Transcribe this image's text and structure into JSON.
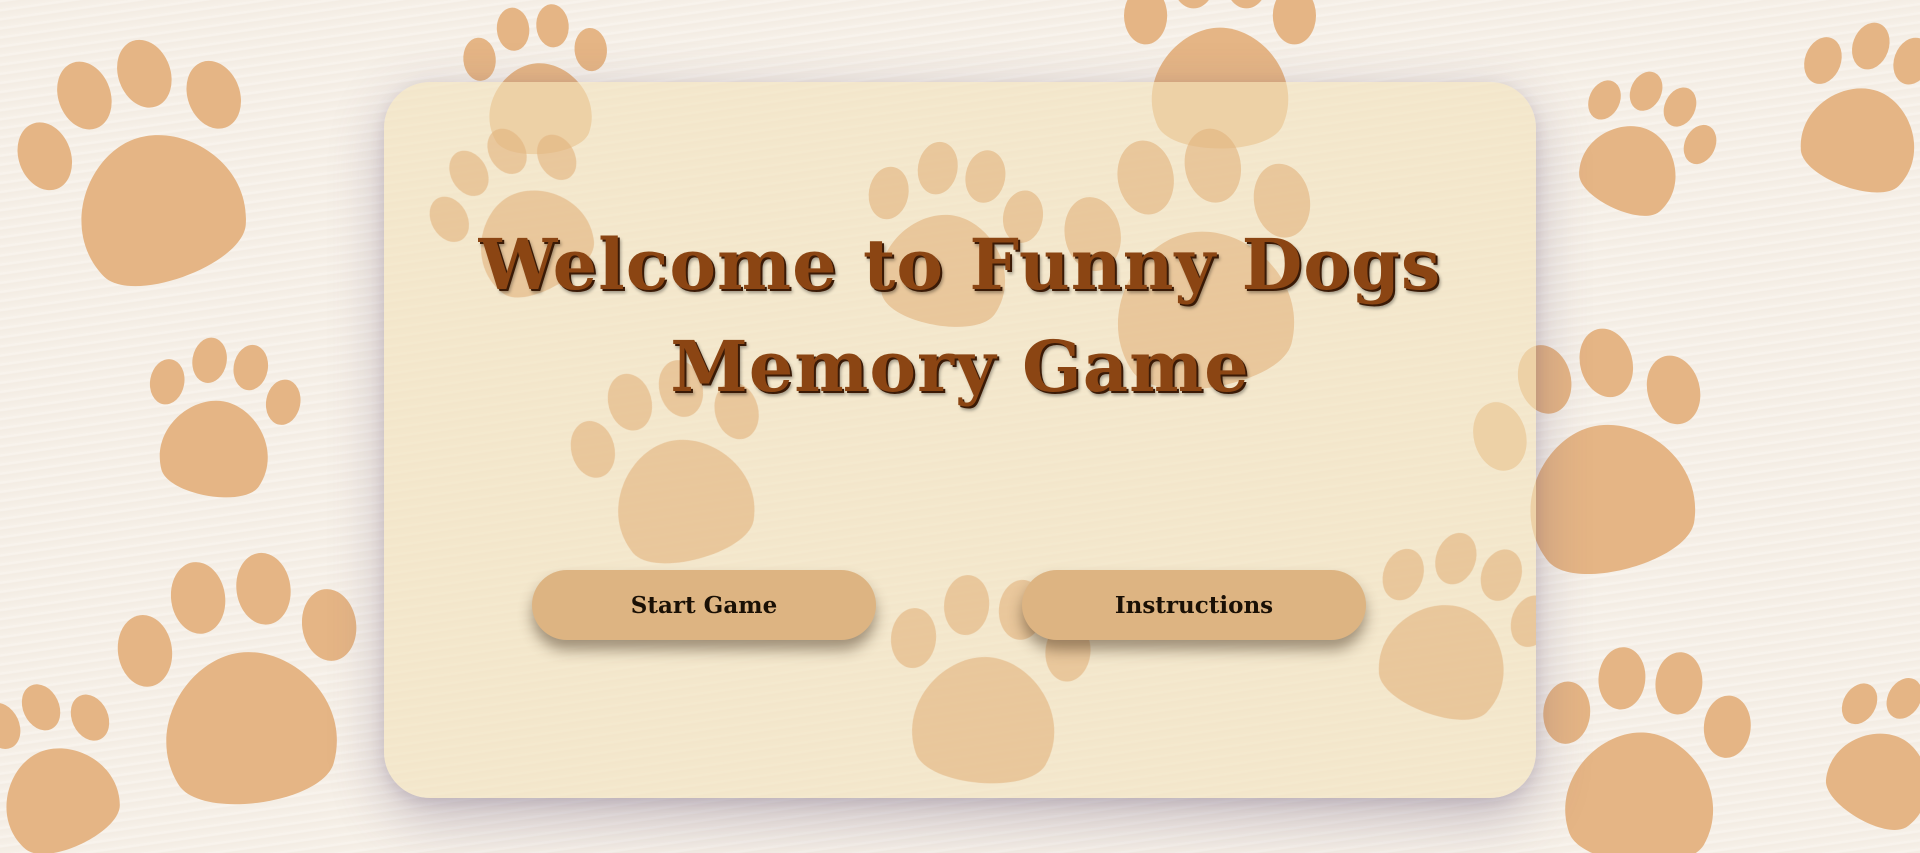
{
  "title": {
    "line1": "Welcome to Funny Dogs",
    "line2": "Memory Game"
  },
  "buttons": {
    "start_label": "Start Game",
    "instructions_label": "Instructions"
  },
  "colors": {
    "background": "#f6f0e8",
    "paw_print": "#e5b585",
    "card": "#f2e2bc",
    "title_text": "#8b4513",
    "button": "#ddb482",
    "button_text": "#1a1005"
  },
  "icons": {
    "background_pattern": "paw-print-icon"
  }
}
